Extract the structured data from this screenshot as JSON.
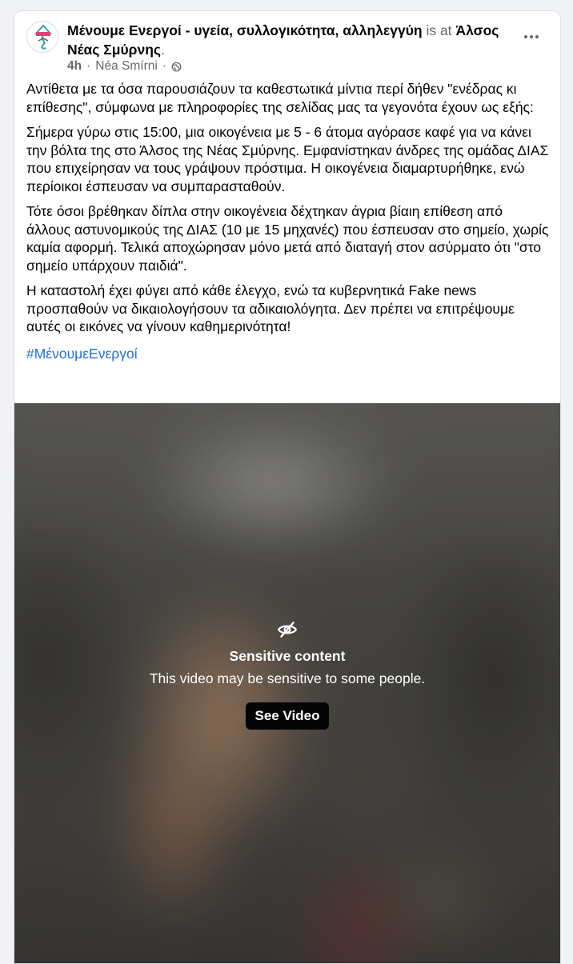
{
  "post": {
    "page_name": "Μένουμε Ενεργοί - υγεία, συλλογικότητα, αλληλεγγύη",
    "is_at": "is at",
    "place_name": "Άλσος Νέας Σμύρνης",
    "place_suffix": ".",
    "time": "4h",
    "separator": "·",
    "location": "Néa Smírni",
    "separator2": "·",
    "paragraphs": [
      "Αντίθετα με τα όσα παρουσιάζουν τα καθεστωτικά μίντια περί δήθεν \"ενέδρας κι επίθεσης\", σύμφωνα με πληροφορίες της σελίδας μας τα γεγονότα έχουν ως εξής:",
      "Σήμερα γύρω στις 15:00, μια οικογένεια με 5 - 6 άτομα αγόρασε καφέ για να κάνει την βόλτα της στο Άλσος της Νέας Σμύρνης. Εμφανίστηκαν άνδρες της ομάδας ΔΙΑΣ που επιχείρησαν να τους γράψουν πρόστιμα. Η οικογένεια διαμαρτυρήθηκε, ενώ περίοικοι έσπευσαν να συμπαρασταθούν.",
      "Τότε όσοι βρέθηκαν δίπλα στην οικογένεια δέχτηκαν άγρια βίαιη επίθεση από άλλους αστυνομικούς της ΔΙΑΣ (10 με 15 μηχανές) που έσπευσαν στο σημείο, χωρίς καμία αφορμή. Τελικά αποχώρησαν μόνο μετά από διαταγή στον ασύρματο ότι \"στο σημείο υπάρχουν παιδιά\".",
      "Η καταστολή έχει φύγει από κάθε έλεγχο, ενώ τα κυβερνητικά Fake news προσπαθούν να δικαιολογήσουν τα αδικαιολόγητα. Δεν πρέπει να επιτρέψουμε αυτές οι εικόνες να γίνουν καθημερινότητα!"
    ],
    "hashtag": "#ΜένουμεΕνεργοί"
  },
  "media": {
    "warning_title": "Sensitive content",
    "warning_text": "This video may be sensitive to some people.",
    "button_label": "See Video"
  },
  "icons": {
    "avatar": "page-logo",
    "audience": "globe-icon",
    "more": "more-options-icon",
    "sensitive": "eye-slash-icon"
  },
  "colors": {
    "link": "#216fdb",
    "secondary_text": "#65676b",
    "button_bg": "#050505"
  }
}
